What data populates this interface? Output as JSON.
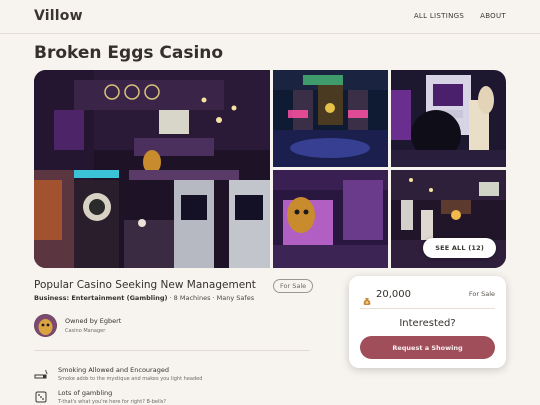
{
  "header": {
    "brand": "Villow",
    "nav": [
      "ALL LISTINGS",
      "ABOUT"
    ]
  },
  "listing": {
    "title": "Broken Eggs Casino",
    "subtitle": "Popular Casino Seeking New Management",
    "status_badge": "For Sale",
    "business_label": "Business: Entertainment (Gambling)",
    "details": "· 8 Machines · Many Safes",
    "owner_name": "Owned by Egbert",
    "owner_role": "Casino Manager"
  },
  "gallery": {
    "see_all_label": "SEE ALL (12)"
  },
  "features": [
    {
      "title": "Smoking Allowed and Encouraged",
      "desc": "Smoke adds to the mystique and makes you light headed",
      "icon": "cigarette-icon"
    },
    {
      "title": "Lots of gambling",
      "desc": "T-that's what you're here for right? B-bells?",
      "icon": "dice-icon"
    }
  ],
  "card": {
    "price": "20,000",
    "status": "For Sale",
    "prompt": "Interested?",
    "cta": "Request a Showing",
    "icon": "coin-bag-icon"
  },
  "colors": {
    "background": "#f7f4ef",
    "accent": "#a04e5a",
    "text": "#35302b"
  }
}
